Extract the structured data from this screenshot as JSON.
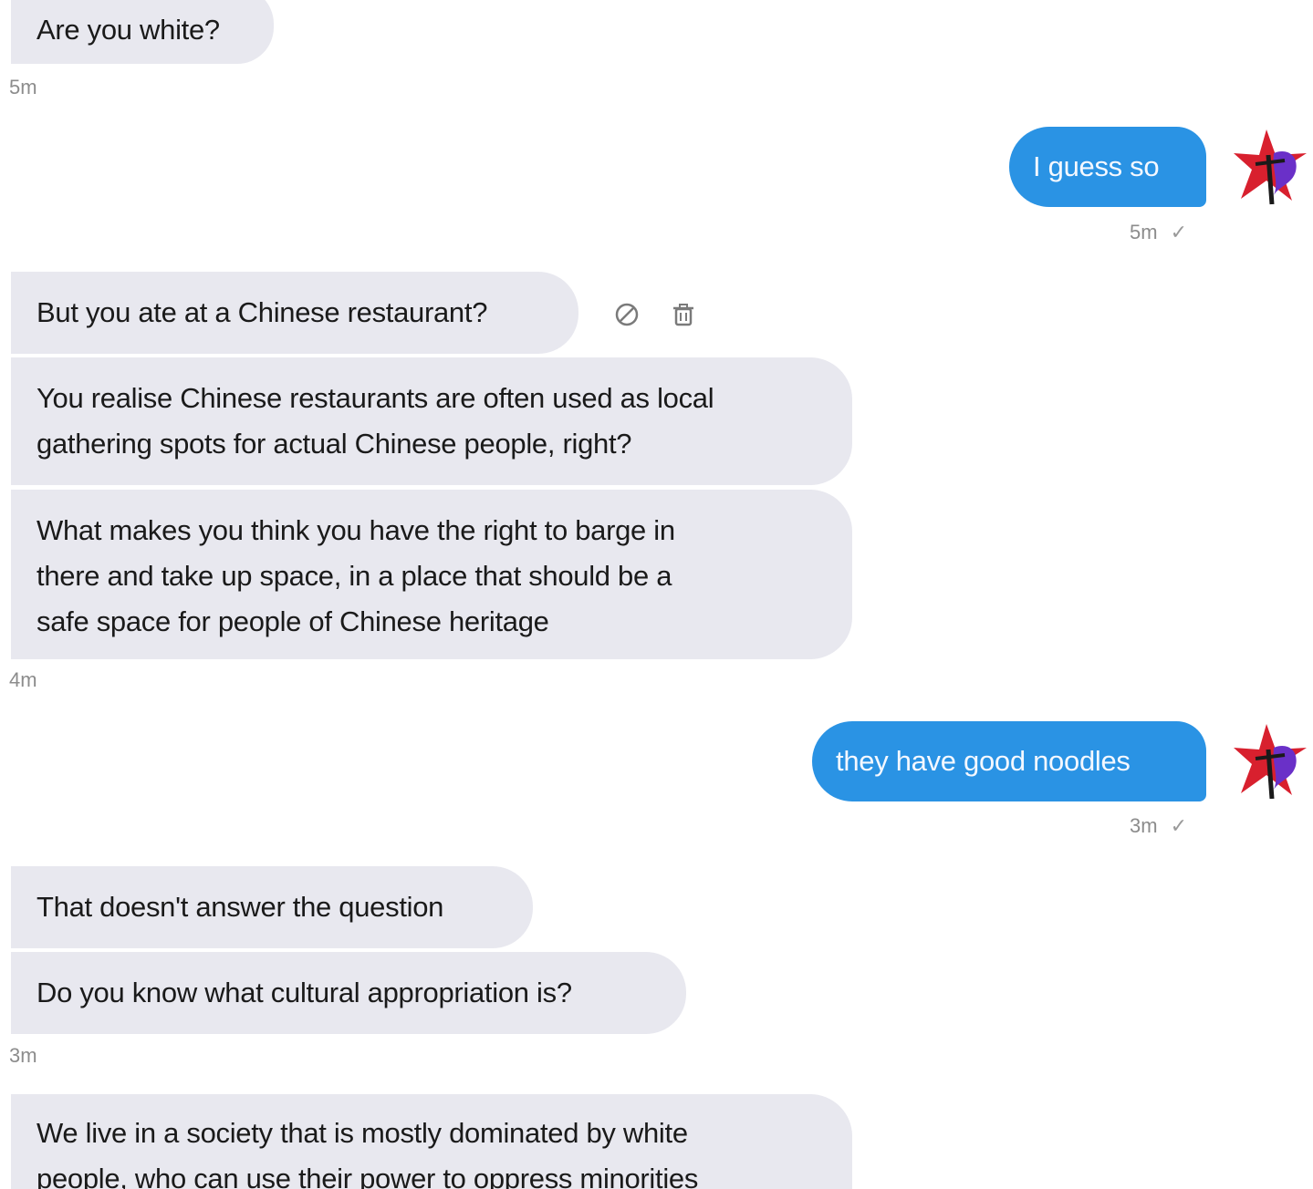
{
  "messages": [
    {
      "text": "Are you white?"
    },
    {
      "text": "I guess so"
    },
    {
      "text": "But you ate at a Chinese restaurant?"
    },
    {
      "text": "You realise Chinese restaurants are often used as local gathering spots for actual Chinese people, right?",
      "lines": [
        "You realise Chinese restaurants are often used as local",
        "gathering spots for actual Chinese people, right?"
      ]
    },
    {
      "text": "What makes you think you have the right to barge in there and take up space, in a place that should be a safe space for people of Chinese heritage",
      "lines": [
        "What makes you think you have the right to barge in",
        "there and take up space, in a place that should be a",
        "safe space for people of Chinese heritage"
      ]
    },
    {
      "text": "they have good noodles"
    },
    {
      "text": "That doesn't answer the question"
    },
    {
      "text": "Do you know what cultural appropriation is?"
    },
    {
      "text": "We live in a society that is mostly dominated by white people, who can use their power to oppress minorities",
      "lines": [
        "We live in a society that is mostly dominated by white",
        "people, who can use their power to oppress minorities"
      ]
    }
  ],
  "timestamps": {
    "t1": "5m",
    "t2": "5m",
    "t3": "4m",
    "t4": "3m",
    "t5": "3m"
  },
  "read_check": "✓",
  "icons": {
    "avatar": "star-avatar-icon",
    "block": "block-icon",
    "delete": "trash-icon"
  },
  "colors": {
    "incoming_bubble": "#e8e8ef",
    "outgoing_bubble": "#2a93e4",
    "timestamp": "#8c8c8c"
  }
}
